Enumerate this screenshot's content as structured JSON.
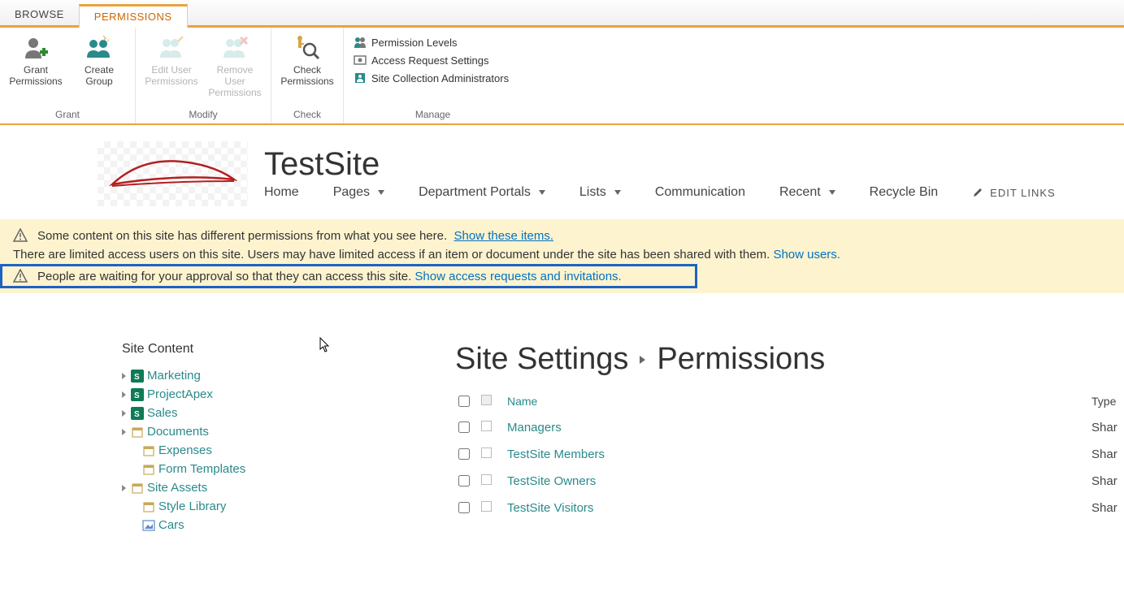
{
  "tabs": {
    "browse": "BROWSE",
    "permissions": "PERMISSIONS"
  },
  "ribbon": {
    "grant": {
      "label": "Grant",
      "grantPermissions": "Grant Permissions",
      "createGroup": "Create Group"
    },
    "modify": {
      "label": "Modify",
      "editUser": "Edit User Permissions",
      "removeUser": "Remove User Permissions"
    },
    "check": {
      "label": "Check",
      "checkPermissions": "Check Permissions"
    },
    "manage": {
      "label": "Manage",
      "permissionLevels": "Permission Levels",
      "accessRequestSettings": "Access Request Settings",
      "siteCollectionAdmins": "Site Collection Administrators"
    }
  },
  "site": {
    "title": "TestSite",
    "nav": {
      "home": "Home",
      "pages": "Pages",
      "department": "Department Portals",
      "lists": "Lists",
      "communication": "Communication",
      "recent": "Recent",
      "recycle": "Recycle Bin",
      "editLinks": "EDIT LINKS"
    }
  },
  "notifications": {
    "line1_text": "Some content on this site has different permissions from what you see here.",
    "line1_link": "Show these items.",
    "line2_text": "There are limited access users on this site. Users may have limited access if an item or document under the site has been shared with them.",
    "line2_link": "Show users.",
    "line3_text": "People are waiting for your approval so that they can access this site.",
    "line3_link": "Show access requests and invitations."
  },
  "sidebar": {
    "title": "Site Content",
    "items": [
      {
        "label": "Marketing",
        "icon": "sp",
        "expandable": true
      },
      {
        "label": "ProjectApex",
        "icon": "sp",
        "expandable": true
      },
      {
        "label": "Sales",
        "icon": "sp",
        "expandable": true
      },
      {
        "label": "Documents",
        "icon": "lib",
        "expandable": true
      },
      {
        "label": "Expenses",
        "icon": "lib",
        "expandable": false
      },
      {
        "label": "Form Templates",
        "icon": "lib",
        "expandable": false
      },
      {
        "label": "Site Assets",
        "icon": "lib",
        "expandable": true
      },
      {
        "label": "Style Library",
        "icon": "lib",
        "expandable": false
      },
      {
        "label": "Cars",
        "icon": "pic",
        "expandable": false
      }
    ]
  },
  "content": {
    "breadcrumb1": "Site Settings",
    "breadcrumb2": "Permissions",
    "columns": {
      "name": "Name",
      "type": "Type"
    },
    "rows": [
      {
        "name": "Managers",
        "type": "Shar"
      },
      {
        "name": "TestSite Members",
        "type": "Shar"
      },
      {
        "name": "TestSite Owners",
        "type": "Shar"
      },
      {
        "name": "TestSite Visitors",
        "type": "Shar"
      }
    ]
  }
}
